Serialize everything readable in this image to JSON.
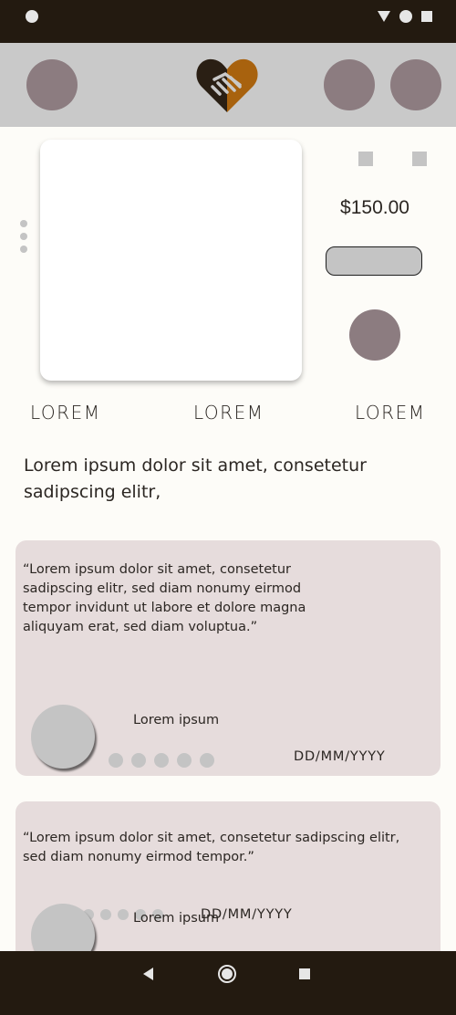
{
  "product": {
    "price": "$150.00",
    "tabs": [
      "LOREM",
      "LOREM",
      "LOREM"
    ],
    "description": "Lorem ipsum dolor sit amet, consetetur sadipscing elitr,"
  },
  "reviews": [
    {
      "quote": "“Lorem ipsum dolor sit amet, consetetur sadipscing elitr, sed diam nonumy eirmod tempor invidunt ut labore et dolore magna aliquyam erat, sed diam voluptua.”",
      "name": "Lorem ipsum",
      "date": "DD/MM/YYYY"
    },
    {
      "quote": "“Lorem ipsum dolor sit amet, consetetur sadipscing elitr, sed diam nonumy eirmod tempor.”",
      "name": "Lorem ipsum",
      "date": "DD/MM/YYYY"
    }
  ],
  "icons": {
    "logo": "handshake-heart-icon",
    "nav": [
      "back-icon",
      "home-icon",
      "recent-apps-icon"
    ]
  },
  "colors": {
    "status_bar": "#231a10",
    "app_bar": "#c9c9c9",
    "placeholder_circle": "#8c7c80",
    "review_card": "#e6dcdc",
    "brand_brown": "#a8620e"
  }
}
